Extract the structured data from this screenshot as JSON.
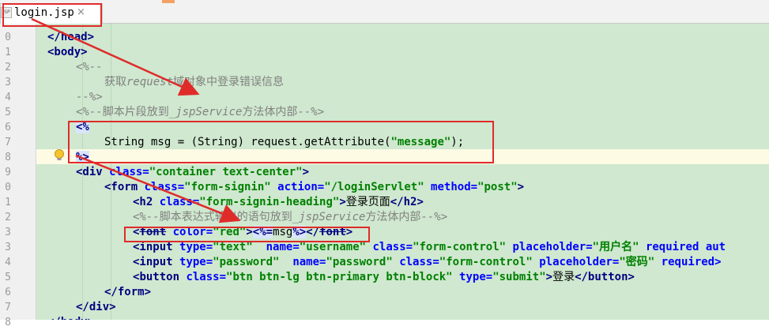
{
  "tab": {
    "label": "login.jsp",
    "icon": "jsp-file-icon",
    "icon_text": "JSP",
    "close": "×"
  },
  "gutter_numbers": [
    "0",
    "1",
    "2",
    "3",
    "4",
    "5",
    "6",
    "7",
    "8",
    "9",
    "0",
    "1",
    "2",
    "3",
    "3",
    "4",
    "5",
    "6",
    "7",
    "8"
  ],
  "lines": [
    {
      "ln": "0",
      "indent": 1,
      "tokens": [
        {
          "t": "</head>",
          "c": "t-tag"
        }
      ]
    },
    {
      "ln": "1",
      "indent": 1,
      "tokens": [
        {
          "t": "<body>",
          "c": "t-tag"
        }
      ]
    },
    {
      "ln": "2",
      "indent": 2,
      "tokens": [
        {
          "t": "<%--",
          "c": "t-cm"
        }
      ]
    },
    {
      "ln": "3",
      "indent": 3,
      "tokens": [
        {
          "t": "获取",
          "c": "t-cmz"
        },
        {
          "t": "request",
          "c": "t-cm"
        },
        {
          "t": "域对象中登录错误信息",
          "c": "t-cmz"
        }
      ]
    },
    {
      "ln": "4",
      "indent": 2,
      "tokens": [
        {
          "t": "--%>",
          "c": "t-cm"
        }
      ]
    },
    {
      "ln": "5",
      "indent": 2,
      "tokens": [
        {
          "t": "<%--",
          "c": "t-cm"
        },
        {
          "t": "脚本片段放到",
          "c": "t-cmz"
        },
        {
          "t": "_jspService",
          "c": "t-cm"
        },
        {
          "t": "方法体内部",
          "c": "t-cmz"
        },
        {
          "t": "--%>",
          "c": "t-cm"
        }
      ]
    },
    {
      "ln": "6",
      "indent": 2,
      "tokens": [
        {
          "t": "<%",
          "c": "t-jsp"
        }
      ]
    },
    {
      "ln": "7",
      "indent": 3,
      "tokens": [
        {
          "t": "String msg = (String) request.getAttribute(",
          "c": ""
        },
        {
          "t": "\"message\"",
          "c": "t-val"
        },
        {
          "t": ");",
          "c": ""
        }
      ]
    },
    {
      "ln": "8",
      "indent": 2,
      "tokens": [
        {
          "t": "%>",
          "c": "t-jsp"
        }
      ]
    },
    {
      "ln": "9",
      "indent": 2,
      "tokens": [
        {
          "t": "<div ",
          "c": "t-tag"
        },
        {
          "t": "class=",
          "c": "t-attr"
        },
        {
          "t": "\"container text-center\"",
          "c": "t-val"
        },
        {
          "t": ">",
          "c": "t-tag"
        }
      ]
    },
    {
      "ln": "0",
      "indent": 3,
      "tokens": [
        {
          "t": "<form ",
          "c": "t-tag"
        },
        {
          "t": "class=",
          "c": "t-attr"
        },
        {
          "t": "\"form-signin\" ",
          "c": "t-val"
        },
        {
          "t": "action=",
          "c": "t-attr"
        },
        {
          "t": "\"/loginServlet\" ",
          "c": "t-val"
        },
        {
          "t": "method=",
          "c": "t-attr"
        },
        {
          "t": "\"post\"",
          "c": "t-val"
        },
        {
          "t": ">",
          "c": "t-tag"
        }
      ]
    },
    {
      "ln": "1",
      "indent": 4,
      "tokens": [
        {
          "t": "<h2 ",
          "c": "t-tag"
        },
        {
          "t": "class=",
          "c": "t-attr"
        },
        {
          "t": "\"form-signin-heading\"",
          "c": "t-val"
        },
        {
          "t": ">",
          "c": "t-tag"
        },
        {
          "t": "登录页面",
          "c": ""
        },
        {
          "t": "</h2>",
          "c": "t-tag"
        }
      ]
    },
    {
      "ln": "2",
      "indent": 4,
      "tokens": [
        {
          "t": "<%--",
          "c": "t-cm"
        },
        {
          "t": "脚本表达式输出的语句放到",
          "c": "t-cmz"
        },
        {
          "t": "_jspService",
          "c": "t-cm"
        },
        {
          "t": "方法体内部",
          "c": "t-cmz"
        },
        {
          "t": "--%>",
          "c": "t-cm"
        }
      ]
    },
    {
      "ln": "3",
      "indent": 4,
      "tokens": [
        {
          "t": "<",
          "c": "t-tag"
        },
        {
          "t": "font",
          "c": "t-tag t-strike"
        },
        {
          "t": " ",
          "c": ""
        },
        {
          "t": "color=",
          "c": "t-attr"
        },
        {
          "t": "\"red\"",
          "c": "t-val"
        },
        {
          "t": ">",
          "c": "t-tag"
        },
        {
          "t": "<%=",
          "c": "t-jsp"
        },
        {
          "t": "msg",
          "c": ""
        },
        {
          "t": "%>",
          "c": "t-jsp"
        },
        {
          "t": "</",
          "c": "t-tag"
        },
        {
          "t": "font",
          "c": "t-tag t-strike"
        },
        {
          "t": ">",
          "c": "t-tag"
        }
      ]
    },
    {
      "ln": "3",
      "indent": 4,
      "tokens": [
        {
          "t": "<input ",
          "c": "t-tag"
        },
        {
          "t": "type=",
          "c": "t-attr"
        },
        {
          "t": "\"text\"  ",
          "c": "t-val"
        },
        {
          "t": "name=",
          "c": "t-attr"
        },
        {
          "t": "\"username\" ",
          "c": "t-val"
        },
        {
          "t": "class=",
          "c": "t-attr"
        },
        {
          "t": "\"form-control\" ",
          "c": "t-val"
        },
        {
          "t": "placeholder=",
          "c": "t-attr"
        },
        {
          "t": "\"用户名\" ",
          "c": "t-val"
        },
        {
          "t": "required ",
          "c": "t-attr"
        },
        {
          "t": "aut",
          "c": "t-attr"
        }
      ]
    },
    {
      "ln": "4",
      "indent": 4,
      "tokens": [
        {
          "t": "<input ",
          "c": "t-tag"
        },
        {
          "t": "type=",
          "c": "t-attr"
        },
        {
          "t": "\"password\"  ",
          "c": "t-val"
        },
        {
          "t": "name=",
          "c": "t-attr"
        },
        {
          "t": "\"password\" ",
          "c": "t-val"
        },
        {
          "t": "class=",
          "c": "t-attr"
        },
        {
          "t": "\"form-control\" ",
          "c": "t-val"
        },
        {
          "t": "placeholder=",
          "c": "t-attr"
        },
        {
          "t": "\"密码\" ",
          "c": "t-val"
        },
        {
          "t": "required>",
          "c": "t-attr"
        }
      ]
    },
    {
      "ln": "5",
      "indent": 4,
      "tokens": [
        {
          "t": "<",
          "c": "t-tag"
        },
        {
          "t": "button ",
          "c": "t-tag"
        },
        {
          "t": "class=",
          "c": "t-attr"
        },
        {
          "t": "\"btn btn-lg btn-primary btn-block\" ",
          "c": "t-val"
        },
        {
          "t": "type=",
          "c": "t-attr"
        },
        {
          "t": "\"submit\"",
          "c": "t-val"
        },
        {
          "t": ">",
          "c": "t-tag"
        },
        {
          "t": "登录",
          "c": ""
        },
        {
          "t": "</button>",
          "c": "t-tag"
        }
      ]
    },
    {
      "ln": "6",
      "indent": 3,
      "tokens": [
        {
          "t": "</form>",
          "c": "t-tag"
        }
      ]
    },
    {
      "ln": "7",
      "indent": 2,
      "tokens": [
        {
          "t": "</div>",
          "c": "t-tag"
        }
      ]
    },
    {
      "ln": "8",
      "indent": 1,
      "tokens": [
        {
          "t": "</body>",
          "c": "t-tag"
        }
      ]
    }
  ],
  "colors": {
    "annotation": "#e02b2b",
    "code_bg": "#cfe8cf"
  }
}
